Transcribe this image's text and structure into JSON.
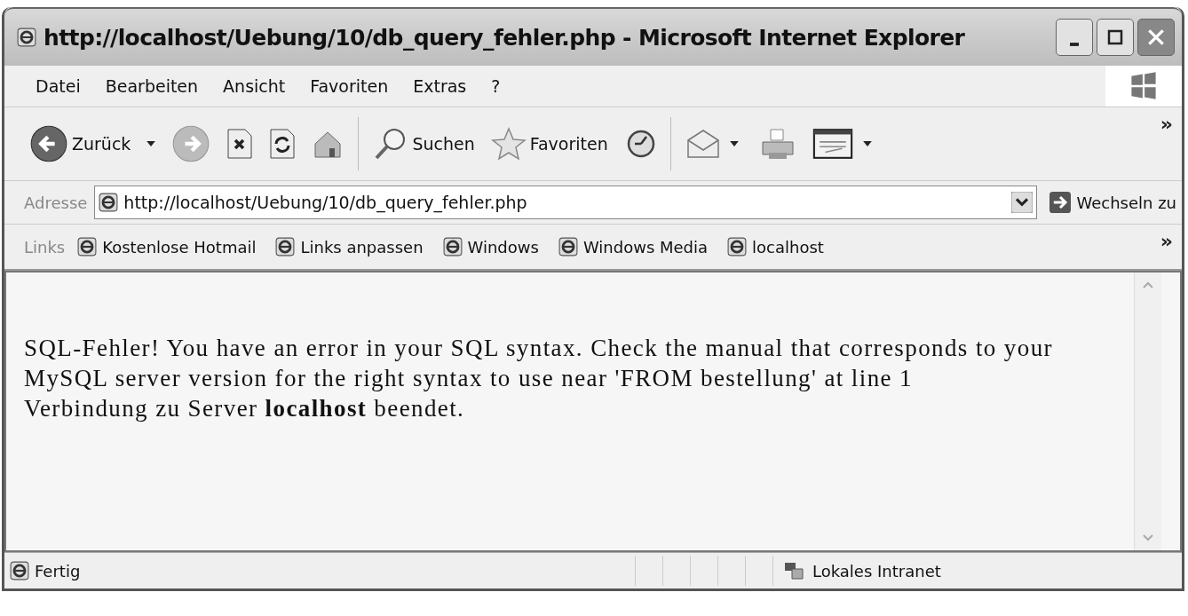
{
  "window": {
    "title": "http://localhost/Uebung/10/db_query_fehler.php - Microsoft Internet Explorer"
  },
  "menu": [
    "Datei",
    "Bearbeiten",
    "Ansicht",
    "Favoriten",
    "Extras",
    "?"
  ],
  "toolbar": [
    {
      "kind": "back",
      "label": "Zurück"
    },
    {
      "kind": "forward"
    },
    {
      "kind": "stop"
    },
    {
      "kind": "refresh"
    },
    {
      "kind": "home"
    },
    {
      "kind": "search",
      "label": "Suchen"
    },
    {
      "kind": "favorites",
      "label": "Favoriten"
    },
    {
      "kind": "history"
    },
    {
      "kind": "mail"
    },
    {
      "kind": "print"
    },
    {
      "kind": "edit"
    }
  ],
  "toolbar_overflow": "»",
  "address": {
    "label": "Adresse",
    "value": "http://localhost/Uebung/10/db_query_fehler.php",
    "go_label": "Wechseln zu"
  },
  "links": {
    "label": "Links",
    "items": [
      "Kostenlose Hotmail",
      "Links anpassen",
      "Windows",
      "Windows Media",
      "localhost"
    ],
    "overflow": "»"
  },
  "content": {
    "paragraphs": [
      "SQL-Fehler! You have an error in your SQL syntax. Check the manual that corresponds to your MySQL server version for the right syntax to use near 'FROM bestellung' at line 1",
      "Verbindung zu Server **localhost** beendet."
    ]
  },
  "status_bar": {
    "text": "Fertig",
    "zone": "Lokales Intranet"
  }
}
